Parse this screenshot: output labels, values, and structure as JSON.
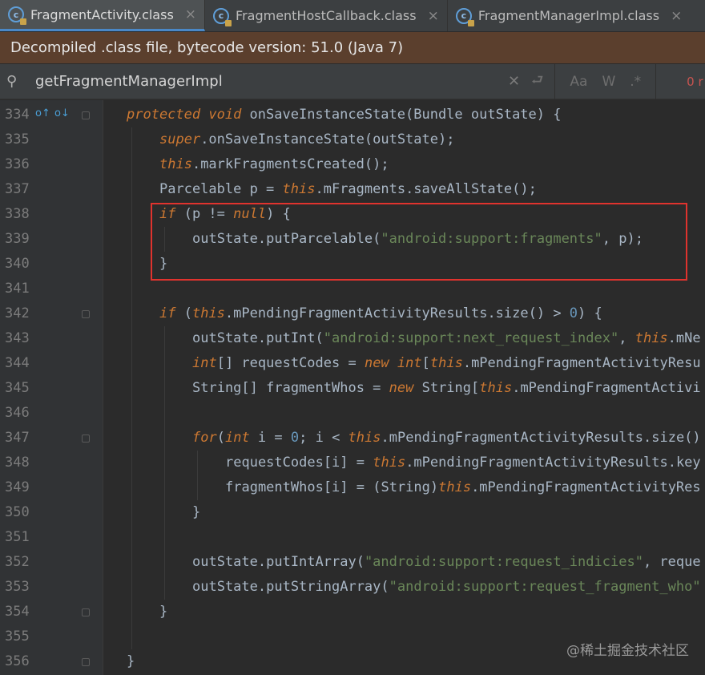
{
  "tabs": [
    {
      "label": "FragmentActivity.class",
      "close": "×"
    },
    {
      "label": "FragmentHostCallback.class",
      "close": "×"
    },
    {
      "label": "FragmentManagerImpl.class",
      "close": "×"
    }
  ],
  "banner": {
    "text": "Decompiled .class file, bytecode version: 51.0 (Java 7)"
  },
  "search": {
    "value": "getFragmentManagerImpl",
    "clear": "✕",
    "replace": "⮐",
    "match_case": "Aa",
    "words": "W",
    "regex": ".*",
    "count": "0 r"
  },
  "code_lines": [
    {
      "n": "334",
      "indent": 0,
      "tokens": [
        [
          "kw",
          "protected "
        ],
        [
          "kw",
          "void "
        ],
        [
          "p",
          "onSaveInstanceState(Bundle outState) {"
        ]
      ]
    },
    {
      "n": "335",
      "indent": 1,
      "tokens": [
        [
          "kw",
          "super"
        ],
        [
          "p",
          ".onSaveInstanceState(outState);"
        ]
      ]
    },
    {
      "n": "336",
      "indent": 1,
      "tokens": [
        [
          "kw",
          "this"
        ],
        [
          "p",
          ".markFragmentsCreated();"
        ]
      ]
    },
    {
      "n": "337",
      "indent": 1,
      "tokens": [
        [
          "p",
          "Parcelable p = "
        ],
        [
          "kw",
          "this"
        ],
        [
          "p",
          ".mFragments.saveAllState();"
        ]
      ]
    },
    {
      "n": "338",
      "indent": 1,
      "tokens": [
        [
          "kw",
          "if "
        ],
        [
          "p",
          "(p != "
        ],
        [
          "kw",
          "null"
        ],
        [
          "p",
          ") {"
        ]
      ]
    },
    {
      "n": "339",
      "indent": 2,
      "tokens": [
        [
          "p",
          "outState.putParcelable("
        ],
        [
          "str",
          "\"android:support:fragments\""
        ],
        [
          "p",
          ", p);"
        ]
      ]
    },
    {
      "n": "340",
      "indent": 1,
      "tokens": [
        [
          "p",
          "}"
        ]
      ]
    },
    {
      "n": "341",
      "indent": 0,
      "tokens": []
    },
    {
      "n": "342",
      "indent": 1,
      "tokens": [
        [
          "kw",
          "if "
        ],
        [
          "p",
          "("
        ],
        [
          "kw",
          "this"
        ],
        [
          "p",
          ".mPendingFragmentActivityResults.size() > "
        ],
        [
          "num",
          "0"
        ],
        [
          "p",
          ") {"
        ]
      ]
    },
    {
      "n": "343",
      "indent": 2,
      "tokens": [
        [
          "p",
          "outState.putInt("
        ],
        [
          "str",
          "\"android:support:next_request_index\""
        ],
        [
          "p",
          ", "
        ],
        [
          "kw",
          "this"
        ],
        [
          "p",
          ".mNe"
        ]
      ]
    },
    {
      "n": "344",
      "indent": 2,
      "tokens": [
        [
          "kw",
          "int"
        ],
        [
          "p",
          "[] requestCodes = "
        ],
        [
          "kw",
          "new "
        ],
        [
          "kw",
          "int"
        ],
        [
          "p",
          "["
        ],
        [
          "kw",
          "this"
        ],
        [
          "p",
          ".mPendingFragmentActivityResu"
        ]
      ]
    },
    {
      "n": "345",
      "indent": 2,
      "tokens": [
        [
          "p",
          "String[] fragmentWhos = "
        ],
        [
          "kw",
          "new "
        ],
        [
          "p",
          "String["
        ],
        [
          "kw",
          "this"
        ],
        [
          "p",
          ".mPendingFragmentActivi"
        ]
      ]
    },
    {
      "n": "346",
      "indent": 0,
      "tokens": []
    },
    {
      "n": "347",
      "indent": 2,
      "tokens": [
        [
          "kw",
          "for"
        ],
        [
          "p",
          "("
        ],
        [
          "kw",
          "int "
        ],
        [
          "p",
          "i = "
        ],
        [
          "num",
          "0"
        ],
        [
          "p",
          "; i < "
        ],
        [
          "kw",
          "this"
        ],
        [
          "p",
          ".mPendingFragmentActivityResults.size()"
        ]
      ]
    },
    {
      "n": "348",
      "indent": 3,
      "tokens": [
        [
          "p",
          "requestCodes[i] = "
        ],
        [
          "kw",
          "this"
        ],
        [
          "p",
          ".mPendingFragmentActivityResults.key"
        ]
      ]
    },
    {
      "n": "349",
      "indent": 3,
      "tokens": [
        [
          "p",
          "fragmentWhos[i] = (String)"
        ],
        [
          "kw",
          "this"
        ],
        [
          "p",
          ".mPendingFragmentActivityRes"
        ]
      ]
    },
    {
      "n": "350",
      "indent": 2,
      "tokens": [
        [
          "p",
          "}"
        ]
      ]
    },
    {
      "n": "351",
      "indent": 0,
      "tokens": []
    },
    {
      "n": "352",
      "indent": 2,
      "tokens": [
        [
          "p",
          "outState.putIntArray("
        ],
        [
          "str",
          "\"android:support:request_indicies\""
        ],
        [
          "p",
          ", reque"
        ]
      ]
    },
    {
      "n": "353",
      "indent": 2,
      "tokens": [
        [
          "p",
          "outState.putStringArray("
        ],
        [
          "str",
          "\"android:support:request_fragment_who\""
        ]
      ]
    },
    {
      "n": "354",
      "indent": 1,
      "tokens": [
        [
          "p",
          "}"
        ]
      ]
    },
    {
      "n": "355",
      "indent": 0,
      "tokens": []
    },
    {
      "n": "356",
      "indent": 0,
      "tokens": [
        [
          "p",
          "}"
        ]
      ]
    }
  ],
  "gutter_icons": {
    "override": "o↑",
    "implement": "o↓"
  },
  "colors": {
    "highlight_box": "#e0332e",
    "keyword": "#cc7832",
    "string": "#6a8759",
    "number": "#6897bb"
  },
  "watermark": "@稀土掘金技术社区"
}
